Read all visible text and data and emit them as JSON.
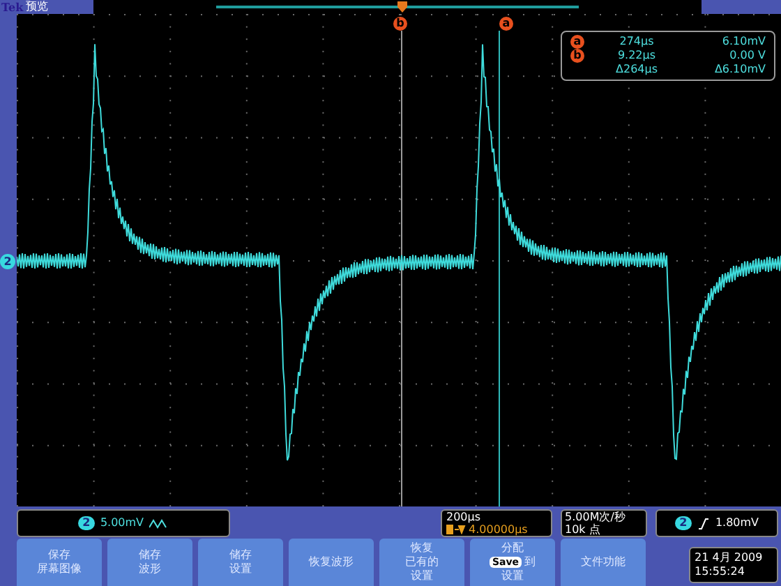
{
  "header": {
    "brand": "Tek",
    "mode": "预览"
  },
  "cursor_markers": [
    {
      "label": "b"
    },
    {
      "label": "a"
    }
  ],
  "channel_marker": "2",
  "cursor_readout": [
    {
      "marker": "a",
      "time": "274µs",
      "value": "6.10mV"
    },
    {
      "marker": "b",
      "time": "9.22µs",
      "value": "0.00 V"
    },
    {
      "time": "Δ264µs",
      "value": "Δ6.10mV"
    }
  ],
  "channel": {
    "number": "2",
    "scale": "5.00mV"
  },
  "timebase": {
    "scale": "200µs",
    "trigger_position": "4.00000µs"
  },
  "acquisition": {
    "sample_rate": "5.00M次/秒",
    "record_length": "10k 点"
  },
  "trigger": {
    "channel": "2",
    "level": "1.80mV"
  },
  "buttons": [
    {
      "lines": [
        "保存",
        "屏幕图像"
      ]
    },
    {
      "lines": [
        "储存",
        "波形"
      ]
    },
    {
      "lines": [
        "储存",
        "设置"
      ]
    },
    {
      "lines": [
        "恢复波形"
      ]
    },
    {
      "lines": [
        "恢复",
        "已有的",
        "设置"
      ]
    },
    {
      "lines": [
        "分配",
        "到",
        "设置"
      ],
      "badge": "Save"
    },
    {
      "lines": [
        "文件功能"
      ]
    }
  ],
  "datetime": {
    "date": "21 4月 2009",
    "time": "15:55:24"
  }
}
